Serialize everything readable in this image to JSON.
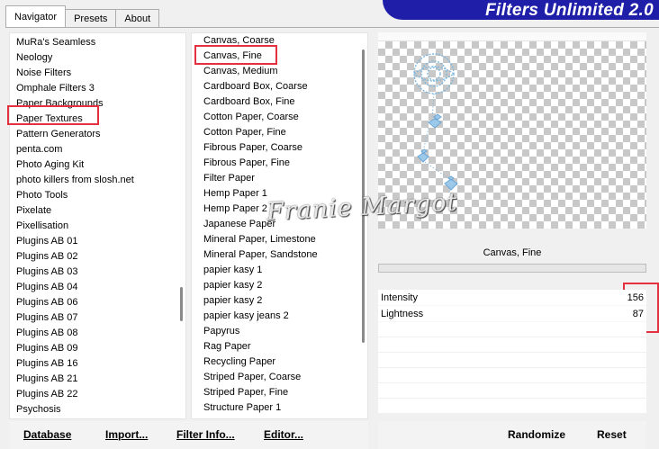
{
  "tabs": [
    "Navigator",
    "Presets",
    "About"
  ],
  "app_title": "Filters Unlimited 2.0",
  "categories": [
    "MuRa's Seamless",
    "Neology",
    "Noise Filters",
    "Omphale Filters 3",
    "Paper Backgrounds",
    "Paper Textures",
    "Pattern Generators",
    "penta.com",
    "Photo Aging Kit",
    "photo killers from slosh.net",
    "Photo Tools",
    "Pixelate",
    "Pixellisation",
    "Plugins AB 01",
    "Plugins AB 02",
    "Plugins AB 03",
    "Plugins AB 04",
    "Plugins AB 06",
    "Plugins AB 07",
    "Plugins AB 08",
    "Plugins AB 09",
    "Plugins AB 16",
    "Plugins AB 21",
    "Plugins AB 22",
    "Psychosis"
  ],
  "filters": [
    "Canvas, Coarse",
    "Canvas, Fine",
    "Canvas, Medium",
    "Cardboard Box, Coarse",
    "Cardboard Box, Fine",
    "Cotton Paper, Coarse",
    "Cotton Paper, Fine",
    "Fibrous Paper, Coarse",
    "Fibrous Paper, Fine",
    "Filter Paper",
    "Hemp Paper 1",
    "Hemp Paper 2",
    "Japanese Paper",
    "Mineral Paper, Limestone",
    "Mineral Paper, Sandstone",
    "papier kasy 1",
    "papier kasy 2",
    "papier kasy 2",
    "papier kasy jeans 2",
    "Papyrus",
    "Rag Paper",
    "Recycling Paper",
    "Striped Paper, Coarse",
    "Striped Paper, Fine",
    "Structure Paper 1"
  ],
  "selected_category": "Paper Textures",
  "selected_filter": "Canvas, Fine",
  "preview": {
    "filter_name": "Canvas, Fine",
    "watermark": "Franie Margot"
  },
  "params": [
    {
      "label": "Intensity",
      "value": "156"
    },
    {
      "label": "Lightness",
      "value": "87"
    }
  ],
  "toolbar": {
    "database": "Database",
    "import": "Import...",
    "filter_info": "Filter Info...",
    "editor": "Editor...",
    "randomize": "Randomize",
    "reset": "Reset"
  },
  "colors": {
    "banner": "#1e1ea8",
    "highlight": "#e53040",
    "checker": "#c8c8c8"
  }
}
